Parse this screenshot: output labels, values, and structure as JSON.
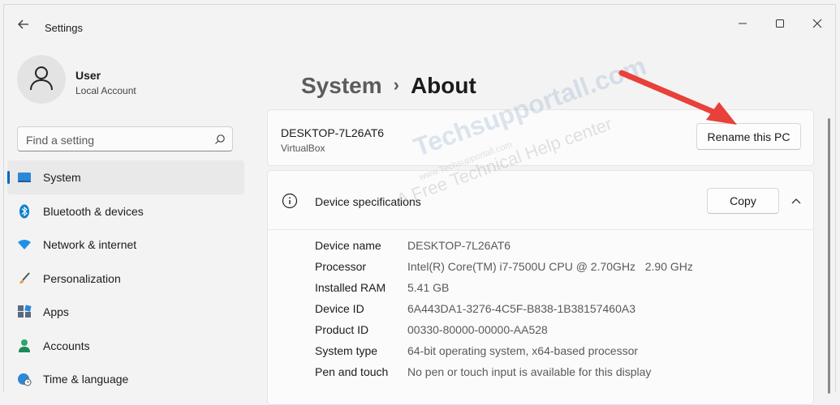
{
  "window": {
    "title": "Settings",
    "colors": {
      "accent": "#0067c0",
      "annotation": "#e8403a"
    }
  },
  "profile": {
    "name": "User",
    "account_type": "Local Account"
  },
  "search": {
    "placeholder": "Find a setting"
  },
  "sidebar": {
    "items": [
      {
        "label": "System",
        "icon": "monitor-icon",
        "active": true
      },
      {
        "label": "Bluetooth & devices",
        "icon": "bluetooth-icon",
        "active": false
      },
      {
        "label": "Network & internet",
        "icon": "wifi-icon",
        "active": false
      },
      {
        "label": "Personalization",
        "icon": "brush-icon",
        "active": false
      },
      {
        "label": "Apps",
        "icon": "apps-icon",
        "active": false
      },
      {
        "label": "Accounts",
        "icon": "person-icon",
        "active": false
      },
      {
        "label": "Time & language",
        "icon": "globe-clock-icon",
        "active": false
      }
    ]
  },
  "breadcrumb": {
    "parent": "System",
    "separator": "›",
    "current": "About"
  },
  "pc_card": {
    "name": "DESKTOP-7L26AT6",
    "subtitle": "VirtualBox",
    "rename_label": "Rename this PC"
  },
  "specs": {
    "title": "Device specifications",
    "copy_label": "Copy",
    "rows": [
      {
        "key": "Device name",
        "value": "DESKTOP-7L26AT6"
      },
      {
        "key": "Processor",
        "value": "Intel(R) Core(TM) i7-7500U CPU @ 2.70GHz   2.90 GHz"
      },
      {
        "key": "Installed RAM",
        "value": "5.41 GB"
      },
      {
        "key": "Device ID",
        "value": "6A443DA1-3276-4C5F-B838-1B38157460A3"
      },
      {
        "key": "Product ID",
        "value": "00330-80000-00000-AA528"
      },
      {
        "key": "System type",
        "value": "64-bit operating system, x64-based processor"
      },
      {
        "key": "Pen and touch",
        "value": "No pen or touch input is available for this display"
      }
    ]
  },
  "watermark": {
    "brand": "Techsupportall.com",
    "url": "www.Techsupportall.com",
    "tagline": "A Free Technical Help center"
  }
}
